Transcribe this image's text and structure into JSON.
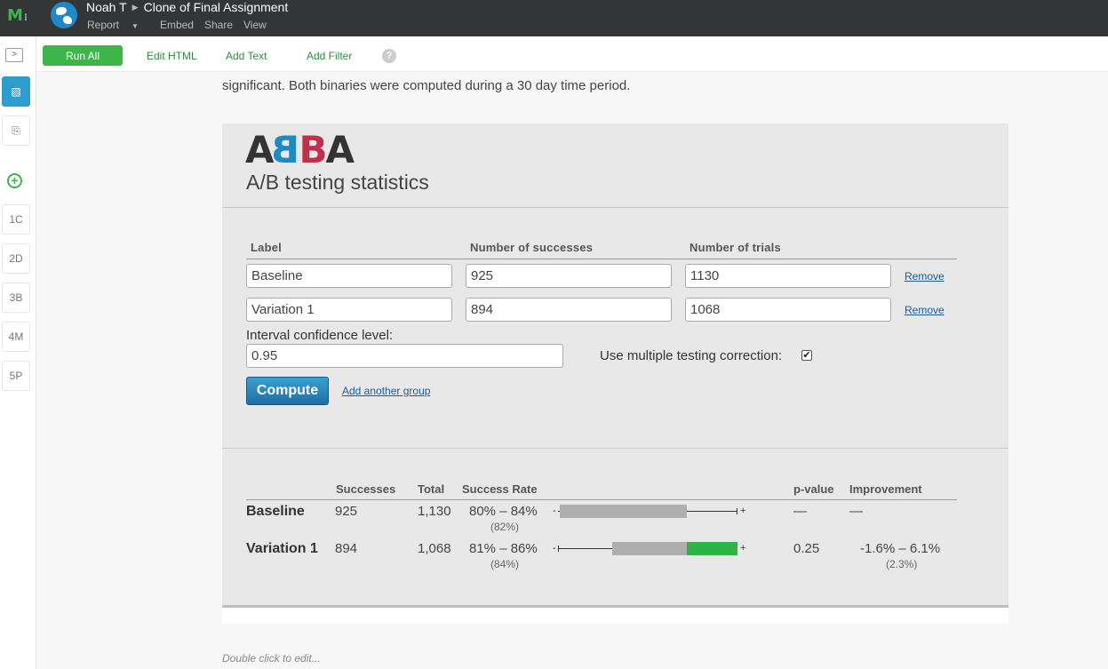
{
  "header": {
    "user": "Noah T",
    "project": "Clone of Final Assignment",
    "menu": [
      "Report",
      "Embed",
      "Share",
      "View"
    ]
  },
  "toolbar": {
    "run_all": "Run All",
    "edit_html": "Edit HTML",
    "add_text": "Add Text",
    "add_filter": "Add Filter",
    "help": "?"
  },
  "leftrail": {
    "items": [
      "1C",
      "2D",
      "3B",
      "4M",
      "5P"
    ]
  },
  "intro_text": "significant. Both binaries were computed during a 30 day time period.",
  "abba": {
    "logo": {
      "a1": "A",
      "b1": "B",
      "b2": "B",
      "a2": "A"
    },
    "subtitle": "A/B testing statistics",
    "columns": {
      "label": "Label",
      "successes": "Number of successes",
      "trials": "Number of trials"
    },
    "groups": [
      {
        "label": "Baseline",
        "successes": "925",
        "trials": "1130",
        "remove": "Remove"
      },
      {
        "label": "Variation 1",
        "successes": "894",
        "trials": "1068",
        "remove": "Remove"
      }
    ],
    "confidence_label": "Interval confidence level:",
    "confidence_value": "0.95",
    "multiple_testing_label": "Use multiple testing correction:",
    "multiple_testing_checked": true,
    "compute": "Compute",
    "add_group": "Add another group"
  },
  "results": {
    "headers": {
      "successes": "Successes",
      "total": "Total",
      "rate": "Success Rate",
      "pvalue": "p-value",
      "improvement": "Improvement"
    },
    "rows": [
      {
        "label": "Baseline",
        "successes": "925",
        "total": "1,130",
        "rate": "80% – 84%",
        "rate_point": "(82%)",
        "pvalue": "—",
        "improvement": "—",
        "improvement_point": ""
      },
      {
        "label": "Variation 1",
        "successes": "894",
        "total": "1,068",
        "rate": "81% – 86%",
        "rate_point": "(84%)",
        "pvalue": "0.25",
        "improvement": "-1.6% – 6.1%",
        "improvement_point": "(2.3%)"
      }
    ],
    "colors": {
      "interval": "#aeaeae",
      "improvement": "#2db443"
    }
  },
  "footer_hint": "Double click to edit..."
}
